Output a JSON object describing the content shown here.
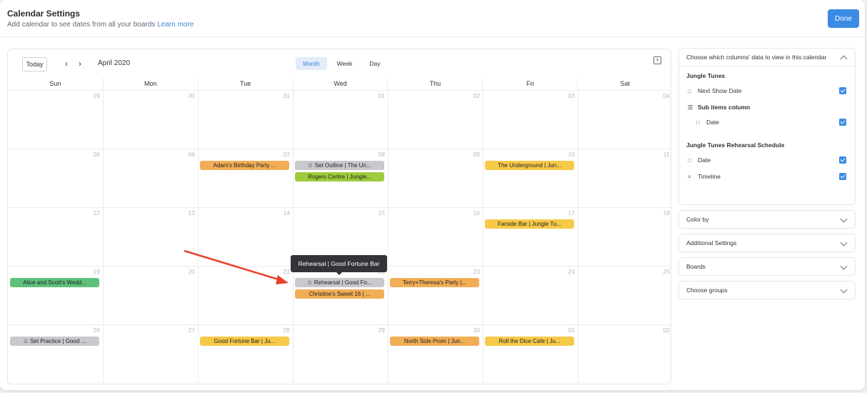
{
  "header": {
    "title": "Calendar Settings",
    "subtitle": "Add calendar to see dates from all your boards",
    "learn_more": "Learn more",
    "done_label": "Done"
  },
  "calendar": {
    "today_label": "Today",
    "month_label": "April 2020",
    "views": [
      "Month",
      "Week",
      "Day"
    ],
    "active_view": "Month",
    "weekdays": [
      "Sun",
      "Mon",
      "Tue",
      "Wed",
      "Thu",
      "Fri",
      "Sat"
    ],
    "weeks": [
      [
        "29",
        "30",
        "31",
        "01",
        "02",
        "03",
        "04"
      ],
      [
        "05",
        "06",
        "07",
        "08",
        "09",
        "10",
        "11"
      ],
      [
        "12",
        "13",
        "14",
        "15",
        "16",
        "17",
        "18"
      ],
      [
        "19",
        "20",
        "21",
        "22",
        "23",
        "24",
        "25"
      ],
      [
        "26",
        "27",
        "28",
        "29",
        "30",
        "01",
        "02"
      ]
    ],
    "events": [
      {
        "week": 1,
        "day": 2,
        "slot": 0,
        "label": "Adam's Birthday Party ...",
        "color": "orange"
      },
      {
        "week": 1,
        "day": 3,
        "slot": 0,
        "label": "Set Outline | The Un...",
        "color": "gray",
        "subitem": true
      },
      {
        "week": 1,
        "day": 3,
        "slot": 1,
        "label": "Rogers Centre | Jungle...",
        "color": "green"
      },
      {
        "week": 1,
        "day": 5,
        "slot": 0,
        "label": "The Underground | Jun...",
        "color": "yellow"
      },
      {
        "week": 2,
        "day": 5,
        "slot": 0,
        "label": "Farside Bar | Jungle Tu...",
        "color": "yellow"
      },
      {
        "week": 3,
        "day": 0,
        "slot": 0,
        "label": "Alice and Scott's Wedd...",
        "color": "teal"
      },
      {
        "week": 3,
        "day": 3,
        "slot": 0,
        "label": "Rehearsal | Good Fo...",
        "color": "gray",
        "subitem": true
      },
      {
        "week": 3,
        "day": 3,
        "slot": 1,
        "label": "Christine's Sweet 16 | ...",
        "color": "orange"
      },
      {
        "week": 3,
        "day": 4,
        "slot": 0,
        "label": "Terry+Theresa's Party |...",
        "color": "orange"
      },
      {
        "week": 4,
        "day": 0,
        "slot": 0,
        "label": "Set Practice | Good ...",
        "color": "gray",
        "subitem": true
      },
      {
        "week": 4,
        "day": 2,
        "slot": 0,
        "label": "Good Fortune Bar | Ju...",
        "color": "yellow"
      },
      {
        "week": 4,
        "day": 4,
        "slot": 0,
        "label": "North Side Prom | Jun...",
        "color": "orange"
      },
      {
        "week": 4,
        "day": 5,
        "slot": 0,
        "label": "Roll the Dice Cafe | Ju...",
        "color": "yellow"
      }
    ],
    "tooltip": "Rehearsal | Good Fortune Bar"
  },
  "settings": {
    "columns_panel_title": "Choose which columns' data to view in this calendar",
    "boards": [
      {
        "name": "Jungle Tunes",
        "items": [
          {
            "label": "Next Show Date",
            "icon": "calendar-icon",
            "checked": true
          },
          {
            "label": "Sub items column",
            "icon": "subitems-icon",
            "header": true
          },
          {
            "label": "Date",
            "icon": "calendar-icon",
            "checked": true,
            "indent": true
          }
        ]
      },
      {
        "name": "Jungle Tunes Rehearsal Schedule",
        "items": [
          {
            "label": "Date",
            "icon": "calendar-icon",
            "checked": true
          },
          {
            "label": "Timeline",
            "icon": "timeline-icon",
            "checked": true
          }
        ]
      }
    ],
    "collapsed_panels": [
      "Color by",
      "Additional Settings",
      "Boards",
      "Choose groups"
    ]
  },
  "colors": {
    "accent": "#3b8be5",
    "orange": "#f2ae56",
    "gray": "#c8c9ce",
    "green": "#9ecb3c",
    "yellow": "#f6c948",
    "teal": "#5fc07a"
  }
}
